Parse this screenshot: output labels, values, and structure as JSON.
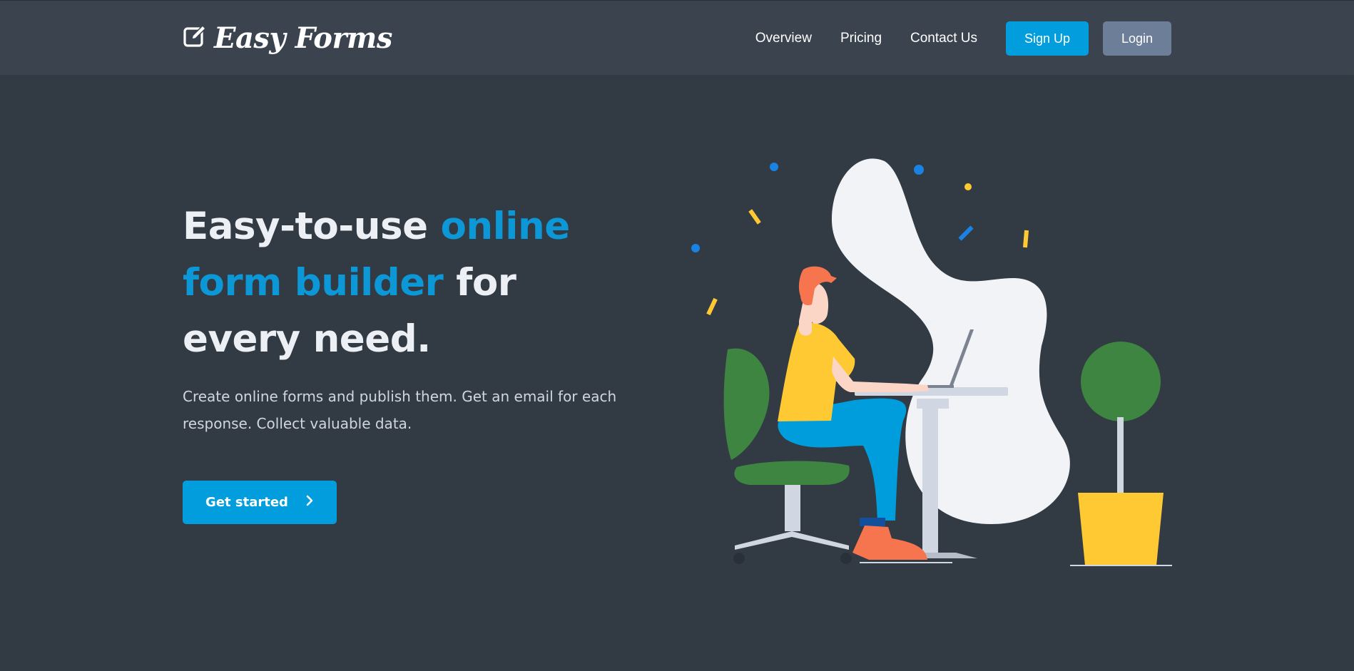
{
  "brand": {
    "name": "Easy Forms",
    "logo_icon": "edit-square-icon"
  },
  "nav": {
    "links": [
      "Overview",
      "Pricing",
      "Contact Us"
    ],
    "signup_label": "Sign Up",
    "login_label": "Login"
  },
  "hero": {
    "title_part1": "Easy-to-use ",
    "title_accent": "online form builder",
    "title_part2": " for every need.",
    "subtitle": "Create online forms and publish them. Get an email for each response. Collect valuable data.",
    "cta_label": "Get started",
    "cta_icon": "chevron-right-icon"
  },
  "colors": {
    "background": "#323a44",
    "navbar": "#3b434e",
    "accent": "#029ddd",
    "login_button": "#6d7f98",
    "plant_green": "#3d8541",
    "shirt_yellow": "#ffc933"
  }
}
